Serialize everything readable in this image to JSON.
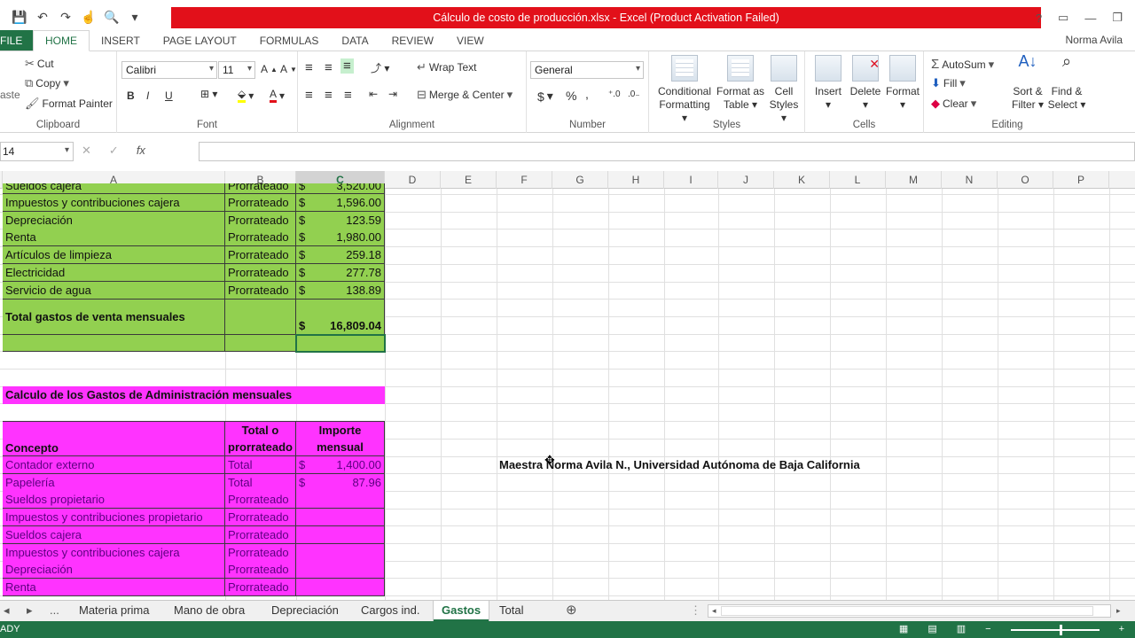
{
  "window": {
    "title": "Cálculo de costo de producción.xlsx -  Excel (Product Activation Failed)",
    "user": "Norma Avila",
    "help": "?",
    "minimize": "—",
    "restore": "❐",
    "close": "✕"
  },
  "ribbon_tabs": [
    "FILE",
    "HOME",
    "INSERT",
    "PAGE LAYOUT",
    "FORMULAS",
    "DATA",
    "REVIEW",
    "VIEW"
  ],
  "clipboard": {
    "paste": "aste",
    "cut": "Cut",
    "copy": "Copy",
    "painter": "Format Painter",
    "label": "Clipboard"
  },
  "font": {
    "name": "Calibri",
    "size": "11",
    "label": "Font",
    "bold": "B",
    "italic": "I",
    "underline": "U"
  },
  "alignment": {
    "wrap": "Wrap Text",
    "merge": "Merge & Center",
    "label": "Alignment"
  },
  "number": {
    "format": "General",
    "currency": "$",
    "percent": "%",
    "comma": ",",
    "label": "Number"
  },
  "styles": {
    "cond1": "Conditional",
    "cond2": "Formatting",
    "table1": "Format as",
    "table2": "Table",
    "cell1": "Cell",
    "cell2": "Styles",
    "label": "Styles"
  },
  "cells": {
    "insert": "Insert",
    "delete": "Delete",
    "format": "Format",
    "label": "Cells"
  },
  "editing": {
    "autosum": "AutoSum",
    "fill": "Fill",
    "clear": "Clear",
    "sort1": "Sort &",
    "sort2": "Filter",
    "find1": "Find &",
    "find2": "Select",
    "label": "Editing"
  },
  "formula_bar": {
    "name_box": "14",
    "cancel": "✕",
    "enter": "✓",
    "fx": "fx",
    "content": ""
  },
  "columns": [
    "A",
    "B",
    "C",
    "D",
    "E",
    "F",
    "G",
    "H",
    "I",
    "J",
    "K",
    "L",
    "M",
    "N",
    "O",
    "P"
  ],
  "sheet": {
    "top_partial": [
      "Sueldos cajera",
      "Prorrateado",
      "$",
      "3,520.00"
    ],
    "sales_rows": [
      [
        "Impuestos y contribuciones cajera",
        "Prorrateado",
        "$",
        "1,596.00"
      ],
      [
        "Depreciación",
        "Prorrateado",
        "$",
        "123.59"
      ],
      [
        "Renta",
        "Prorrateado",
        "$",
        "1,980.00"
      ],
      [
        "Artículos de limpieza",
        "Prorrateado",
        "$",
        "259.18"
      ],
      [
        "Electricidad",
        "Prorrateado",
        "$",
        "277.78"
      ],
      [
        "Servicio de agua",
        "Prorrateado",
        "$",
        "138.89"
      ]
    ],
    "sales_total": [
      "Total gastos de venta mensuales",
      "$",
      "16,809.04"
    ],
    "admin_title": "Calculo de los Gastos de Administración mensuales",
    "admin_header": {
      "concept": "Concepto",
      "type1": "Total o",
      "type2": "prorrateado",
      "amount1": "Importe",
      "amount2": "mensual"
    },
    "admin_rows": [
      [
        "Contador externo",
        "Total",
        "$",
        "1,400.00"
      ],
      [
        "Papelería",
        "Total",
        "$",
        "87.96"
      ],
      [
        "Sueldos propietario",
        "Prorrateado",
        "",
        ""
      ],
      [
        "Impuestos y contribuciones propietario",
        "Prorrateado",
        "",
        ""
      ],
      [
        "Sueldos cajera",
        "Prorrateado",
        "",
        ""
      ],
      [
        "Impuestos y contribuciones cajera",
        "Prorrateado",
        "",
        ""
      ],
      [
        "Depreciación",
        "Prorrateado",
        "",
        ""
      ],
      [
        "Renta",
        "Prorrateado",
        "",
        ""
      ]
    ],
    "credit": "Maestra Norma Avila N., Universidad Autónoma de Baja California"
  },
  "sheet_tabs": [
    "Materia prima",
    "Mano de obra",
    "Depreciación",
    "Cargos ind.",
    "Gastos",
    "Total"
  ],
  "active_sheet": "Gastos",
  "status": {
    "text": "ADY"
  },
  "colors": {
    "green_fill": "#92d050",
    "magenta_fill": "#ff33ff",
    "excel_green": "#217346",
    "title_red": "#e2101a"
  }
}
